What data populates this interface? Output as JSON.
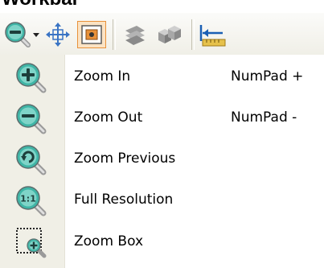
{
  "window": {
    "title_fragment": "Workbar"
  },
  "toolbar": {
    "buttons": [
      {
        "name": "zoom-out-icon"
      },
      {
        "name": "dropdown-arrow-icon"
      },
      {
        "name": "pan-icon"
      },
      {
        "name": "fit-to-window-icon"
      },
      {
        "name": "layers-icon"
      },
      {
        "name": "shapes-3d-icon"
      },
      {
        "name": "measure-icon"
      }
    ]
  },
  "menu": {
    "items": [
      {
        "label": "Zoom In",
        "shortcut": "NumPad +",
        "icon": "zoom-in-icon"
      },
      {
        "label": "Zoom Out",
        "shortcut": "NumPad -",
        "icon": "zoom-out-icon"
      },
      {
        "label": "Zoom Previous",
        "shortcut": "",
        "icon": "zoom-previous-icon"
      },
      {
        "label": "Full Resolution",
        "shortcut": "",
        "icon": "full-resolution-icon"
      },
      {
        "label": "Zoom Box",
        "shortcut": "",
        "icon": "zoom-box-icon"
      }
    ]
  },
  "colors": {
    "magnifier_teal": "#2a9d8f",
    "magnifier_handle": "#c8c8c8",
    "gutter": "#f0efe6",
    "accent_orange": "#e8913a"
  }
}
